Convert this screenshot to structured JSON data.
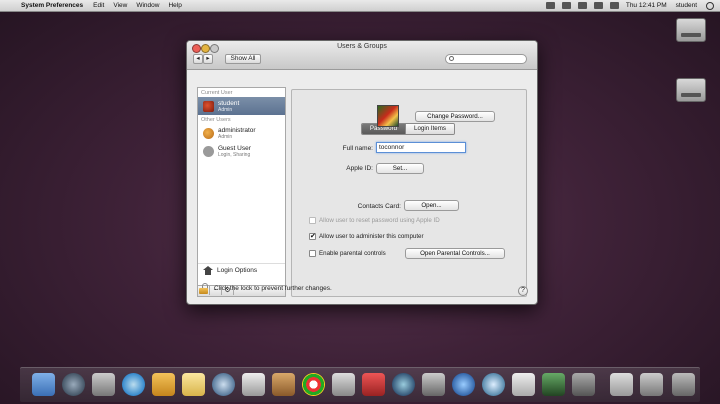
{
  "menubar": {
    "app_name": "System Preferences",
    "menus": [
      "Edit",
      "View",
      "Window",
      "Help"
    ],
    "clock": "Thu 12:41 PM",
    "username": "student"
  },
  "window": {
    "title": "Users & Groups",
    "show_all": "Show All",
    "search_placeholder": ""
  },
  "sidebar": {
    "current_user_header": "Current User",
    "current_user": {
      "name": "student",
      "role": "Admin"
    },
    "other_users_header": "Other Users",
    "other_users": [
      {
        "name": "administrator",
        "role": "Admin"
      },
      {
        "name": "Guest User",
        "role": "Login, Sharing"
      }
    ],
    "login_options": "Login Options",
    "add": "+",
    "remove": "−",
    "gear": "⚙"
  },
  "tabs": {
    "password": "Password",
    "login_items": "Login Items"
  },
  "form": {
    "change_password": "Change Password...",
    "full_name_label": "Full name:",
    "full_name_value": "toconnor",
    "apple_id_label": "Apple ID:",
    "set_button": "Set...",
    "contacts_label": "Contacts Card:",
    "open_button": "Open...",
    "reset_pw_label": "Allow user to reset password using Apple ID",
    "admin_label": "Allow user to administer this computer",
    "parental_label": "Enable parental controls",
    "parental_button": "Open Parental Controls..."
  },
  "footer": {
    "lock_text": "Click the lock to prevent further changes.",
    "help": "?"
  }
}
